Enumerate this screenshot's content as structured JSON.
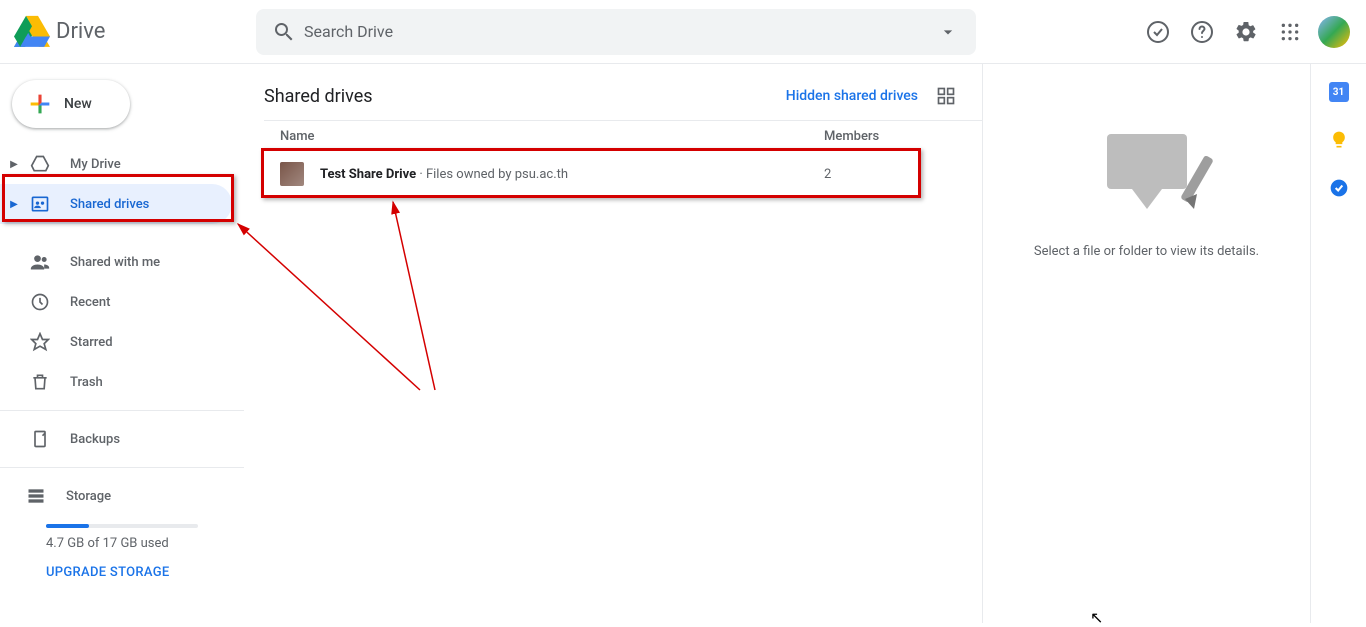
{
  "header": {
    "app_name": "Drive",
    "search_placeholder": "Search Drive"
  },
  "sidebar": {
    "new_label": "New",
    "items": [
      {
        "label": "My Drive"
      },
      {
        "label": "Shared drives"
      },
      {
        "label": "Shared with me"
      },
      {
        "label": "Recent"
      },
      {
        "label": "Starred"
      },
      {
        "label": "Trash"
      },
      {
        "label": "Backups"
      }
    ],
    "storage": {
      "heading": "Storage",
      "used_text": "4.7 GB of 17 GB used",
      "upgrade_label": "UPGRADE STORAGE"
    }
  },
  "main": {
    "page_title": "Shared drives",
    "hidden_link": "Hidden shared drives",
    "columns": {
      "name": "Name",
      "members": "Members"
    },
    "row": {
      "name": "Test Share Drive",
      "owner_prefix": " · Files owned by ",
      "owner": "psu.ac.th",
      "members": "2"
    }
  },
  "details": {
    "empty_text": "Select a file or folder to view its details."
  }
}
